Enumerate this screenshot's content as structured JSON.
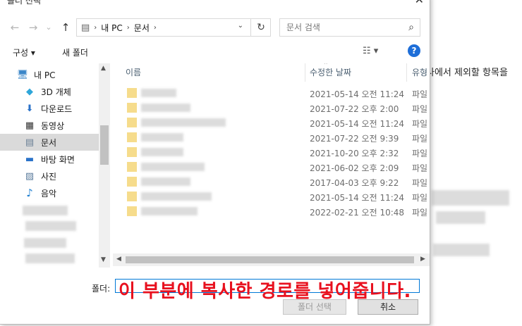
{
  "window": {
    "title": "폴더 선택",
    "close_glyph": "✕"
  },
  "navigation": {
    "back_glyph": "←",
    "forward_glyph": "→",
    "recent_glyph": "⌄",
    "up_glyph": "↑",
    "address_segments": [
      "내 PC",
      "문서"
    ],
    "address_separator": "›",
    "dropdown_glyph": "⌄",
    "refresh_glyph": "↻",
    "search_placeholder": "문서 검색",
    "search_glyph": "⌕"
  },
  "toolbar": {
    "organize_label": "구성 ▾",
    "new_folder_label": "새 폴더",
    "view_glyph": "☷ ▾",
    "help_glyph": "?"
  },
  "sidebar": {
    "items": [
      {
        "label": "내 PC",
        "icon": "pc-icon",
        "glyph": "🖥"
      },
      {
        "label": "3D 개체",
        "icon": "cube-icon",
        "glyph": "◆"
      },
      {
        "label": "다운로드",
        "icon": "download-icon",
        "glyph": "⬇"
      },
      {
        "label": "동영상",
        "icon": "video-icon",
        "glyph": "▦"
      },
      {
        "label": "문서",
        "icon": "document-icon",
        "glyph": "▤"
      },
      {
        "label": "바탕 화면",
        "icon": "desktop-icon",
        "glyph": "▬"
      },
      {
        "label": "사진",
        "icon": "picture-icon",
        "glyph": "▨"
      },
      {
        "label": "음악",
        "icon": "music-icon",
        "glyph": "♪"
      }
    ],
    "selected": "문서"
  },
  "filelist": {
    "columns": [
      "이름",
      "수정한 날짜",
      "유형"
    ],
    "rows": [
      {
        "date": "2021-05-14 오전 11:24",
        "type": "파일"
      },
      {
        "date": "2021-07-22 오후 2:00",
        "type": "파일"
      },
      {
        "date": "2021-05-14 오전 11:24",
        "type": "파일"
      },
      {
        "date": "2021-07-22 오전 9:39",
        "type": "파일"
      },
      {
        "date": "2021-10-20 오후 2:32",
        "type": "파일"
      },
      {
        "date": "2021-06-02 오후 2:09",
        "type": "파일"
      },
      {
        "date": "2017-04-03 오후 9:22",
        "type": "파일"
      },
      {
        "date": "2021-05-14 오전 11:24",
        "type": "파일"
      },
      {
        "date": "2022-02-21 오전 10:48",
        "type": "파일"
      }
    ]
  },
  "footer": {
    "folder_label": "폴더:",
    "folder_value": "",
    "select_button": "폴더 선택",
    "cancel_button": "취소"
  },
  "annotation": {
    "text": "이 부분에 복사한 경로를 넣어줍니다.",
    "color": "#e8101e"
  },
  "background": {
    "text": "사에서 제외할 항목을"
  },
  "colors": {
    "accent": "#0078d7",
    "selected_bg": "#dadada",
    "folder_icon": "#f6dc8c"
  }
}
